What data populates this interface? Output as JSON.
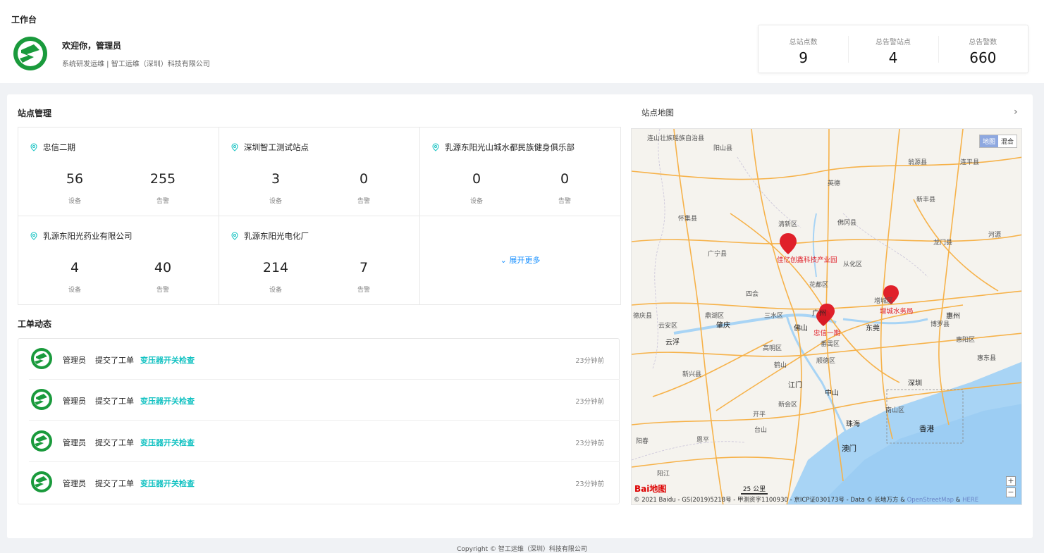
{
  "header": {
    "workspace_title": "工作台",
    "welcome": "欢迎你，管理员",
    "org_line": "系统研发运维 | 智工运维（深圳）科技有限公司"
  },
  "stats": [
    {
      "label": "总站点数",
      "value": "9"
    },
    {
      "label": "总告警站点",
      "value": "4"
    },
    {
      "label": "总告警数",
      "value": "660"
    }
  ],
  "sites": {
    "title": "站点管理",
    "device_label": "设备",
    "alarm_label": "告警",
    "items": [
      {
        "name": "忠信二期",
        "devices": "56",
        "alarms": "255"
      },
      {
        "name": "深圳智工测试站点",
        "devices": "3",
        "alarms": "0"
      },
      {
        "name": "乳源东阳光山城水都民族健身俱乐部",
        "devices": "0",
        "alarms": "0"
      },
      {
        "name": "乳源东阳光药业有限公司",
        "devices": "4",
        "alarms": "40"
      },
      {
        "name": "乳源东阳光电化厂",
        "devices": "214",
        "alarms": "7"
      }
    ],
    "expand_label": "展开更多"
  },
  "orders": {
    "title": "工单动态",
    "items": [
      {
        "user": "管理员",
        "action": "提交了工单",
        "link": "变压器开关检查",
        "time": "23分钟前"
      },
      {
        "user": "管理员",
        "action": "提交了工单",
        "link": "变压器开关检查",
        "time": "23分钟前"
      },
      {
        "user": "管理员",
        "action": "提交了工单",
        "link": "变压器开关检查",
        "time": "23分钟前"
      },
      {
        "user": "管理员",
        "action": "提交了工单",
        "link": "变压器开关检查",
        "time": "23分钟前"
      }
    ]
  },
  "map": {
    "title": "站点地图",
    "toggle": [
      "地图",
      "混合"
    ],
    "markers": [
      "佳亿创鑫科技产业园",
      "增城水务局",
      "忠信一期"
    ],
    "places": [
      "连山壮族瑶族自治县",
      "阳山县",
      "英德",
      "翁源县",
      "连平县",
      "新丰县",
      "怀集县",
      "清新区",
      "佛冈县",
      "龙门县",
      "河源",
      "广宁县",
      "从化区",
      "花都区",
      "增城区",
      "四会",
      "鼎湖区",
      "三水区",
      "广州",
      "惠州",
      "德庆县",
      "云安区",
      "肇庆",
      "佛山",
      "东莞",
      "惠阳区",
      "高明区",
      "番禺区",
      "博罗县",
      "惠东县",
      "云浮",
      "鹤山",
      "顺德区",
      "新兴县",
      "江门",
      "深圳",
      "新会区",
      "中山",
      "开平",
      "香港",
      "台山",
      "珠海",
      "澳门",
      "恩平",
      "阳春",
      "阳江",
      "南山区"
    ],
    "scale": "25 公里",
    "baidu": "Bai地图",
    "attribution": "© 2021 Baidu - GS(2019)5218号 - 甲测资字1100930 - 京ICP证030173号 - Data © 长地万方 & ",
    "attr_link1": "OpenStreetMap",
    "attr_amp": " & ",
    "attr_link2": "HERE",
    "zoom_in": "+",
    "zoom_out": "−"
  },
  "footer": "Copyright © 智工运维（深圳）科技有限公司",
  "colors": {
    "brand_green": "#1a9a3c",
    "accent": "#13c2c2",
    "marker_red": "#e0202a"
  }
}
